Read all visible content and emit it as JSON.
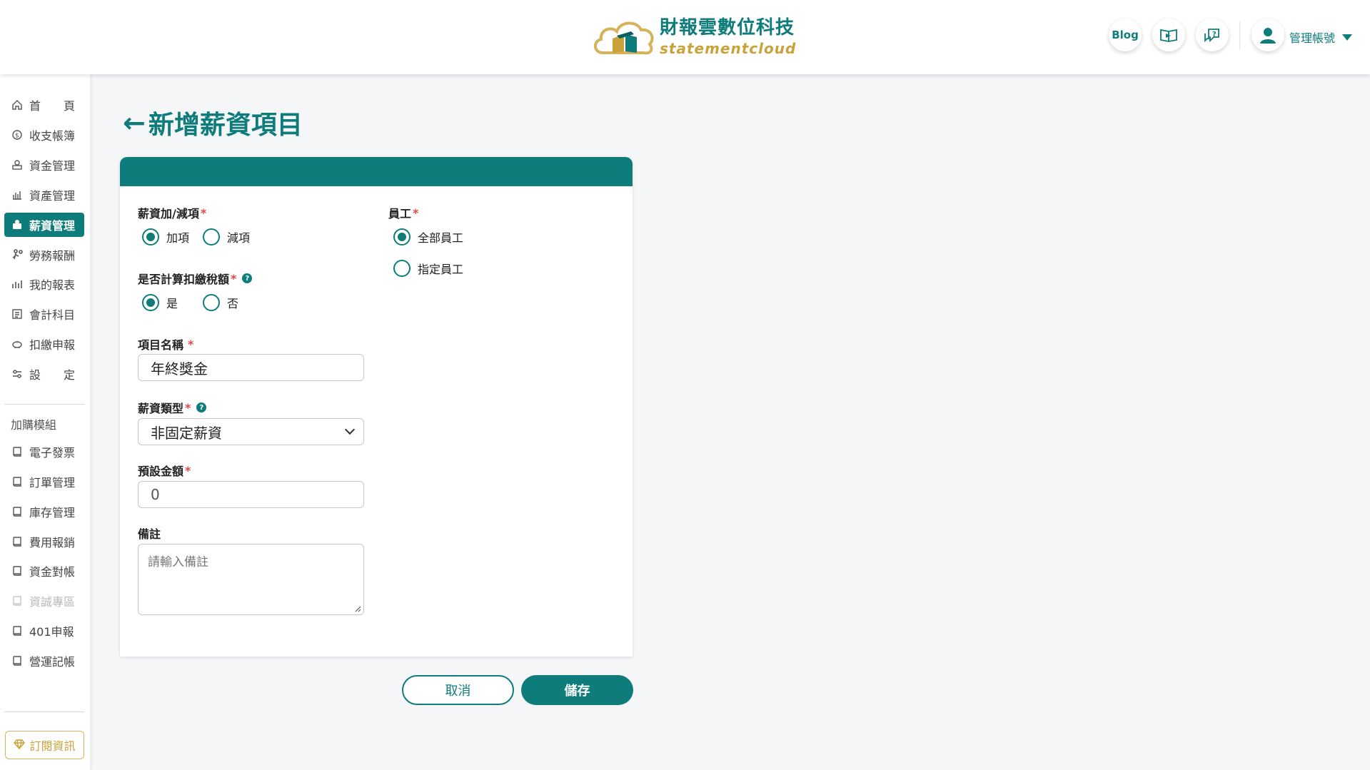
{
  "brand": {
    "name_zh": "財報雲數位科技",
    "name_en": "statementcloud"
  },
  "header": {
    "blog_label": "Blog",
    "account_label": "管理帳號"
  },
  "sidebar": {
    "items": [
      {
        "label": "首　　頁",
        "icon": "home-icon"
      },
      {
        "label": "收支帳簿",
        "icon": "coin-icon"
      },
      {
        "label": "資金管理",
        "icon": "funds-icon"
      },
      {
        "label": "資產管理",
        "icon": "asset-icon"
      },
      {
        "label": "薪資管理",
        "icon": "payroll-icon",
        "active": true
      },
      {
        "label": "勞務報酬",
        "icon": "labor-icon"
      },
      {
        "label": "我的報表",
        "icon": "chart-icon"
      },
      {
        "label": "會計科目",
        "icon": "ledger-icon"
      },
      {
        "label": "扣繳申報",
        "icon": "piggy-icon"
      },
      {
        "label": "設　　定",
        "icon": "settings-icon"
      }
    ],
    "addon_section": "加購模組",
    "addons": [
      {
        "label": "電子發票",
        "icon": "book-icon"
      },
      {
        "label": "訂單管理",
        "icon": "book-icon"
      },
      {
        "label": "庫存管理",
        "icon": "book-icon"
      },
      {
        "label": "費用報銷",
        "icon": "book-icon"
      },
      {
        "label": "資金對帳",
        "icon": "book-icon"
      },
      {
        "label": "資誠專區",
        "icon": "book-icon",
        "disabled": true
      },
      {
        "label": "401申報",
        "icon": "book-icon"
      },
      {
        "label": "營運記帳",
        "icon": "book-icon"
      }
    ],
    "subscribe_label": "訂閱資訊"
  },
  "page": {
    "back_arrow": "←",
    "title": "新增薪資項目"
  },
  "form": {
    "add_sub": {
      "label": "薪資加/減項",
      "options": [
        "加項",
        "減項"
      ],
      "selected": 0
    },
    "withholding": {
      "label": "是否計算扣繳稅額",
      "options": [
        "是",
        "否"
      ],
      "selected": 0
    },
    "item_name": {
      "label": "項目名稱",
      "value": "年終獎金"
    },
    "salary_type": {
      "label": "薪資類型",
      "value": "非固定薪資"
    },
    "default_amount": {
      "label": "預設金額",
      "placeholder": "0"
    },
    "note": {
      "label": "備註",
      "placeholder": "請輸入備註"
    },
    "employee": {
      "label": "員工",
      "options": [
        "全部員工",
        "指定員工"
      ],
      "selected": 0
    },
    "required_mark": "*",
    "help_mark": "?"
  },
  "actions": {
    "cancel_label": "取消",
    "save_label": "儲存"
  },
  "colors": {
    "primary": "#0e7c7b",
    "gold": "#c9a23a",
    "required": "#e04848"
  }
}
